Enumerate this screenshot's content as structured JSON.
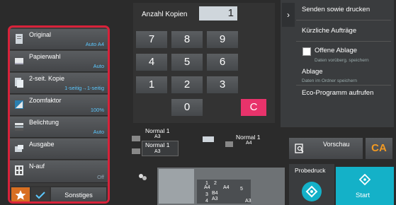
{
  "settings": {
    "items": [
      {
        "label": "Original",
        "value": "Auto A4",
        "icon": "original-icon"
      },
      {
        "label": "Papierwahl",
        "value": "Auto",
        "icon": "paper-select-icon"
      },
      {
        "label": "2-seit. Kopie",
        "value": "1-seitig→1-seitig",
        "icon": "duplex-icon"
      },
      {
        "label": "Zoomfaktor",
        "value": "100%",
        "icon": "zoom-icon"
      },
      {
        "label": "Belichtung",
        "value": "Auto",
        "icon": "exposure-icon"
      },
      {
        "label": "Ausgabe",
        "value": "",
        "icon": "output-icon"
      },
      {
        "label": "N-auf",
        "value": "Off",
        "icon": "n-up-icon"
      }
    ],
    "tabs": {
      "favorites_icon": "star-icon",
      "check_icon": "check-icon",
      "other_label": "Sonstiges"
    }
  },
  "copies": {
    "label": "Anzahl Kopien",
    "value": "1"
  },
  "keypad": {
    "keys": [
      "7",
      "8",
      "9",
      "4",
      "5",
      "6",
      "1",
      "2",
      "3",
      "0"
    ],
    "clear_label": "C"
  },
  "right_panel": {
    "send_print": "Senden sowie drucken",
    "recent_jobs": "Kürzliche Aufträge",
    "open_filing": "Offene Ablage",
    "open_filing_sub": "Daten vorüberg. speichern",
    "filing": "Ablage",
    "filing_sub": "Daten im Ordner speichern",
    "eco": "Eco-Programm aufrufen"
  },
  "preview_label": "Vorschau",
  "ca_label": "CA",
  "test_print_label": "Probedruck",
  "start_label": "Start",
  "diagram": {
    "tray1_label": "Normal 1",
    "tray1_size": "A3",
    "tray2_label": "Normal 1",
    "tray2_size": "A3",
    "output_label": "Normal 1",
    "output_size": "A4",
    "cassettes": [
      {
        "num": "1",
        "size": "A4"
      },
      {
        "num": "2",
        "size": "A4"
      },
      {
        "num": "3",
        "size": "B4"
      },
      {
        "num": "4",
        "size": "A3"
      },
      {
        "num": "5",
        "size": "A3"
      }
    ]
  },
  "colors": {
    "accent_red": "#d8223a",
    "value_blue": "#5bc8ff",
    "start_cyan": "#14b1c8",
    "clear_pink": "#e8336b",
    "ca_orange": "#f39a22",
    "star_orange": "#d86f22"
  }
}
